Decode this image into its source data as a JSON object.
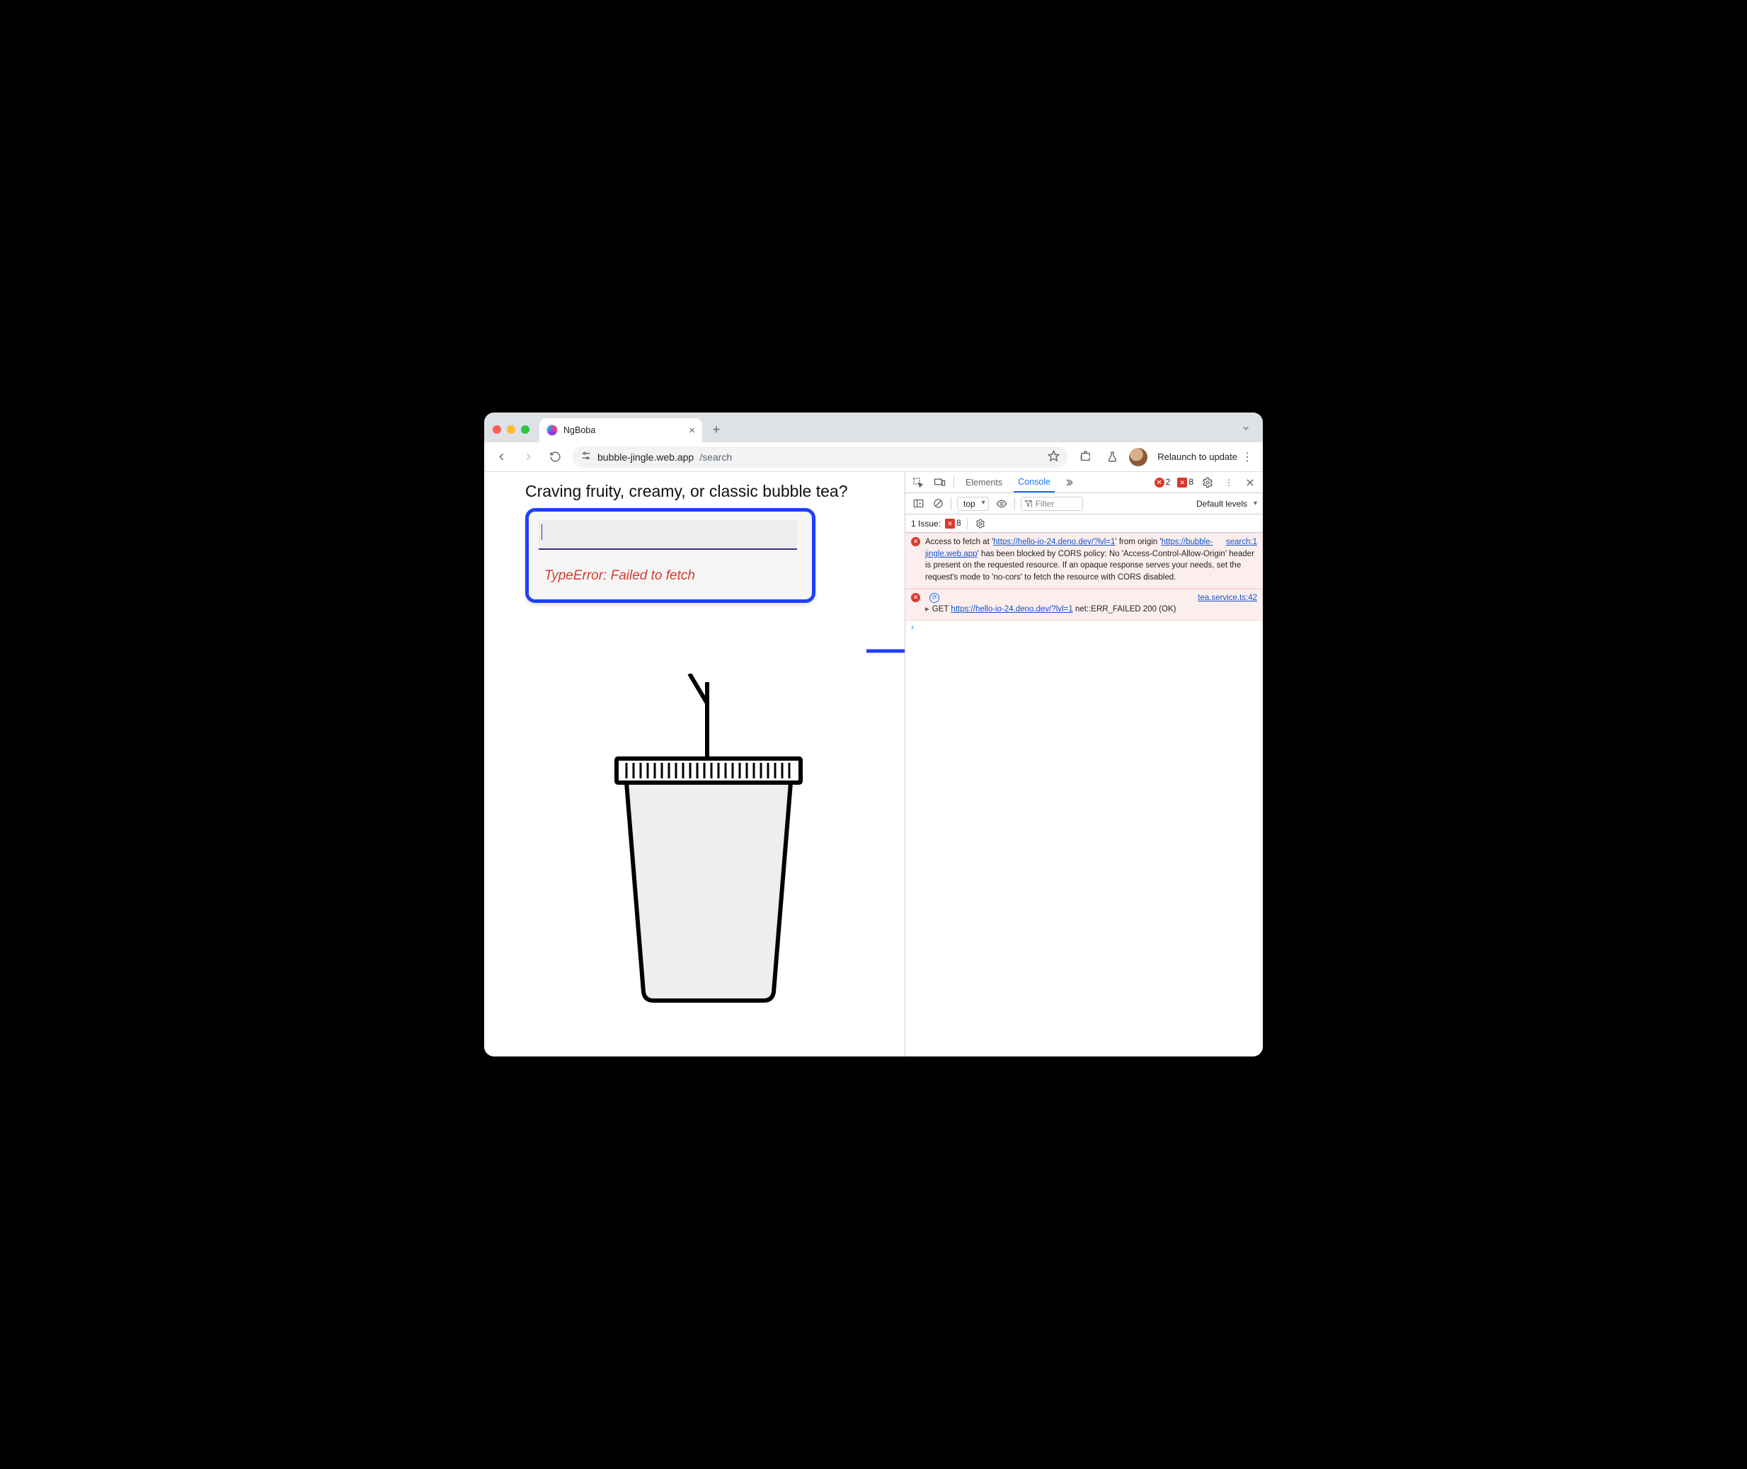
{
  "browser": {
    "tab_title": "NgBoba",
    "url_host": "bubble-jingle.web.app",
    "url_path": "/search",
    "relaunch_label": "Relaunch to update"
  },
  "page": {
    "heading": "Craving fruity, creamy, or classic bubble tea?",
    "input_value": "",
    "error_text": "TypeError: Failed to fetch"
  },
  "devtools": {
    "tabs": {
      "elements": "Elements",
      "console": "Console"
    },
    "error_badge": "2",
    "warn_badge": "8",
    "context": "top",
    "filter_placeholder": "Filter",
    "levels_label": "Default levels",
    "issue_label": "1 Issue:",
    "issue_count": "8",
    "entries": [
      {
        "source": "search:1",
        "pre": "Access to fetch at '",
        "link1": "https://hello-io-24.deno.dev/?lvl=1",
        "mid1": "' from origin '",
        "link2": "https://bubble-jingle.web.app",
        "post": "' has been blocked by CORS policy: No 'Access-Control-Allow-Origin' header is present on the requested resource. If an opaque response serves your needs, set the request's mode to 'no-cors' to fetch the resource with CORS disabled."
      },
      {
        "source": "tea.service.ts:42",
        "method": "GET",
        "link": "https://hello-io-24.deno.dev/?lvl=1",
        "tail": " net::ERR_FAILED 200 (OK)"
      }
    ]
  }
}
